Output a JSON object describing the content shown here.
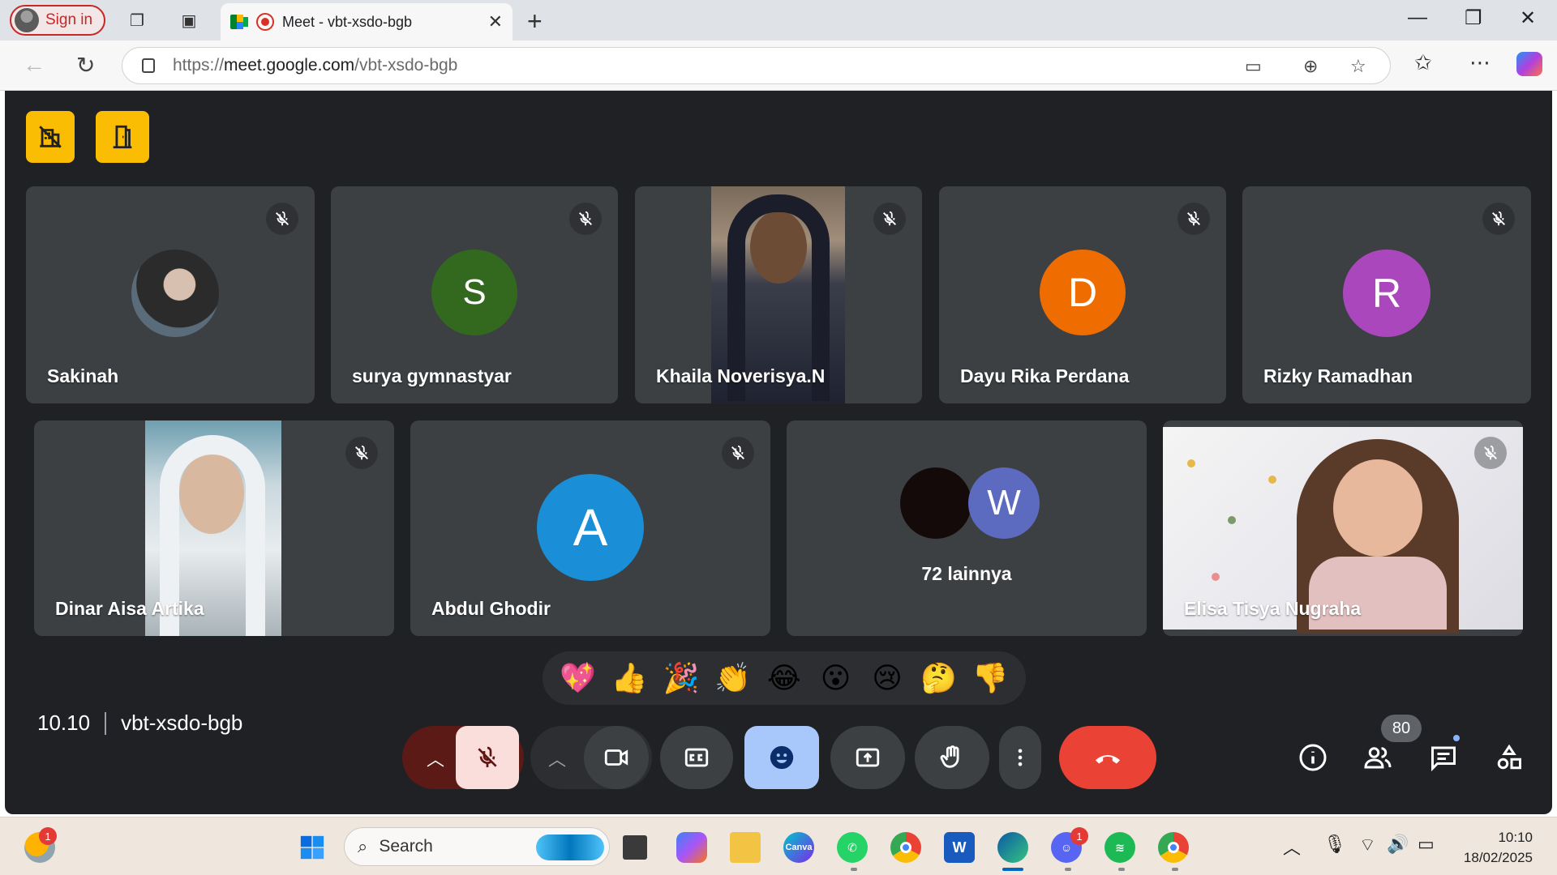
{
  "browser": {
    "sign_in": "Sign in",
    "tab_title": "Meet - vbt-xsdo-bgb",
    "url_prefix": "https://",
    "url_host": "meet.google.com",
    "url_path": "/vbt-xsdo-bgb",
    "accent": "#c62828"
  },
  "meet": {
    "background": "#202124",
    "tile_color": "#3c4043",
    "participants_row1": [
      {
        "name": "Sakinah",
        "type": "photo"
      },
      {
        "name": "surya gymnastyar",
        "type": "letter",
        "letter": "S",
        "color": "#33691e"
      },
      {
        "name": "Khaila Noverisya.N",
        "type": "video"
      },
      {
        "name": "Dayu Rika Perdana",
        "type": "letter",
        "letter": "D",
        "color": "#ef6c00"
      },
      {
        "name": "Rizky Ramadhan",
        "type": "letter",
        "letter": "R",
        "color": "#ab47bc"
      }
    ],
    "participants_row2": [
      {
        "name": "Dinar Aisa Artika",
        "type": "video"
      },
      {
        "name": "Abdul Ghodir",
        "type": "letter",
        "letter": "A",
        "color": "#1a8ed6"
      },
      {
        "name": "72 lainnya",
        "type": "group",
        "letter": "W",
        "color": "#5c6bc0"
      },
      {
        "name": "Elisa Tisya Nugraha",
        "type": "video"
      }
    ],
    "reactions": [
      "💖",
      "👍",
      "🎉",
      "👏",
      "😂",
      "😮",
      "😢",
      "🤔",
      "👎"
    ],
    "time": "10.10",
    "meeting_code": "vbt-xsdo-bgb",
    "people_count": "80",
    "end_call_color": "#ea4335",
    "reaction_active_color": "#a8c7fa"
  },
  "taskbar": {
    "search_placeholder": "Search",
    "weather_badge": "1",
    "discord_badge": "1",
    "clock_time": "10:10",
    "clock_date": "18/02/2025",
    "apps": [
      "Windows",
      "Files",
      "Copilot",
      "File Explorer",
      "Canva",
      "WhatsApp",
      "Chrome",
      "Word",
      "Edge",
      "Discord",
      "Spotify",
      "Chrome Profile"
    ]
  }
}
